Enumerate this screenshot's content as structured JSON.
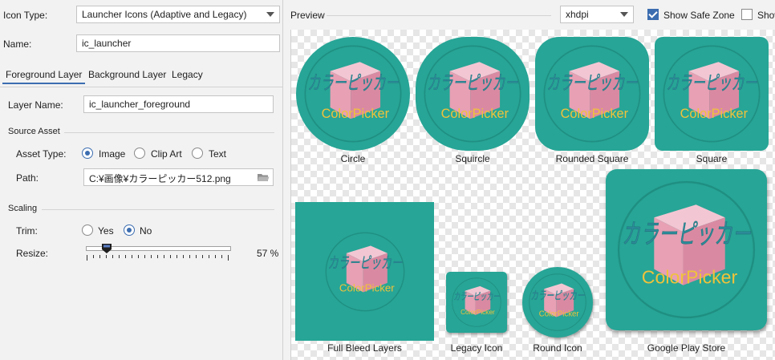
{
  "icon_type": {
    "label": "Icon Type:",
    "value": "Launcher Icons (Adaptive and Legacy)"
  },
  "name": {
    "label": "Name:",
    "value": "ic_launcher"
  },
  "tabs": [
    {
      "label": "Foreground Layer",
      "active": true
    },
    {
      "label": "Background Layer",
      "active": false
    },
    {
      "label": "Legacy",
      "active": false
    }
  ],
  "layer_name": {
    "label": "Layer Name:",
    "value": "ic_launcher_foreground"
  },
  "source_asset": {
    "section": "Source Asset",
    "asset_type_label": "Asset Type:",
    "options": [
      "Image",
      "Clip Art",
      "Text"
    ],
    "selected": "Image",
    "path_label": "Path:",
    "path_value": "C:¥画像¥カラーピッカー512.png"
  },
  "scaling": {
    "section": "Scaling",
    "trim_label": "Trim:",
    "trim_options": [
      "Yes",
      "No"
    ],
    "trim_selected": "No",
    "resize_label": "Resize:",
    "resize_percent": 57,
    "resize_display": "57 %"
  },
  "preview": {
    "label": "Preview",
    "density": "xhdpi",
    "show_safe_zone": {
      "label": "Show Safe Zone",
      "checked": true
    },
    "show_grid": {
      "label": "Show",
      "checked": false
    }
  },
  "icon_art": {
    "kana": "カラーピッカー",
    "latin": "ColorPicker",
    "colors": {
      "bg": "#27a596",
      "cube": "#e7a0b4",
      "kana": "#2d8c9a",
      "latin": "#f0c23a"
    }
  },
  "previews": [
    {
      "label": "Circle",
      "shape": "circle"
    },
    {
      "label": "Squircle",
      "shape": "squircle"
    },
    {
      "label": "Rounded Square",
      "shape": "rounded"
    },
    {
      "label": "Square",
      "shape": "square"
    },
    {
      "label": "Full Bleed Layers",
      "shape": "fullbleed"
    },
    {
      "label": "Legacy Icon",
      "shape": "legacy"
    },
    {
      "label": "Round Icon",
      "shape": "round"
    },
    {
      "label": "Google Play Store",
      "shape": "play"
    }
  ]
}
